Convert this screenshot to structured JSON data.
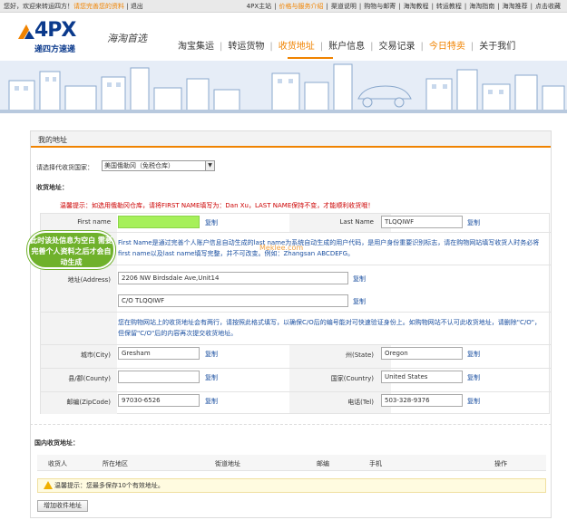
{
  "topbar": {
    "welcome": "您好，欢迎来转运四方！",
    "profile_link": "请您完善您的资料",
    "logout": "退出",
    "links": [
      "4PX主站",
      "价格与服务介绍",
      "渠道说明",
      "购物与邮寄",
      "海淘教程",
      "转运教程",
      "海淘指南",
      "海淘推荐",
      "点击收藏"
    ],
    "highlight_index": 1
  },
  "logo": {
    "brand": "4PX",
    "subtitle": "递四方速递",
    "slogan": "海淘首选"
  },
  "nav": {
    "items": [
      "淘宝集运",
      "转运货物",
      "收货地址",
      "账户信息",
      "交易记录",
      "今日特卖",
      "关于我们"
    ],
    "active_index": 2,
    "special_index": 5
  },
  "page": {
    "title": "我的地址",
    "country_label": "请选择代收货国家：",
    "country_value": "美国俄勒冈（免税仓库）",
    "address_section": "收货地址：",
    "hint1": "温馨提示：如选用俄勒冈仓库，请将FIRST NAME填写为：Dan Xu，LAST NAME保持不变，才能顺利收货哦！",
    "hint2": "First Name是通过完善个人账户信息自动生成的last name为系统自动生成的用户代码，是用户身份重要识别标志，请在购物网站填写收货人时务必将first name以及last name填写完整，并不可改变。例如：Zhangsan ABCDEFG。",
    "hint3": "您在购物网站上的收货地址会有两行，请按照此格式填写，以确保C/O后的编号能对可快速验证身份上。如购物网站不认可此收货地址，请删除\"C/O\"，但保留\"C/O\"后的内容再次提交收货地址。",
    "copy": "复制",
    "callout": "此时该处信息为空白 需要完善个人资料之后才会自动生成",
    "watermark": "Meklee.com"
  },
  "fields": {
    "first_name": {
      "label": "First name",
      "value": ""
    },
    "last_name": {
      "label": "Last Name",
      "value": "TLQQIWF"
    },
    "address": {
      "label": "地址(Address)",
      "line1": "2206 NW Birdsdale Ave,Unit14",
      "line2": "C/O  TLQQIWF"
    },
    "city": {
      "label": "城市(City)",
      "value": "Gresham"
    },
    "state": {
      "label": "州(State)",
      "value": "Oregon"
    },
    "county": {
      "label": "县/郡(County)",
      "value": ""
    },
    "country": {
      "label": "国家(Country)",
      "value": "United States"
    },
    "zip": {
      "label": "邮编(ZipCode)",
      "value": "97030-6526"
    },
    "tel": {
      "label": "电话(Tel)",
      "value": "503-328-9376"
    }
  },
  "domestic": {
    "title": "国内收货地址：",
    "columns": [
      "收货人",
      "所在地区",
      "街道地址",
      "邮编",
      "手机",
      "操作"
    ],
    "notice": "温馨提示：您最多保存10个有效地址。",
    "add_button": "增加收件地址"
  },
  "colors": {
    "accent": "#f08300",
    "highlight": "#a6f05a",
    "callout": "#6fb12b",
    "link": "#1a4fa0"
  }
}
